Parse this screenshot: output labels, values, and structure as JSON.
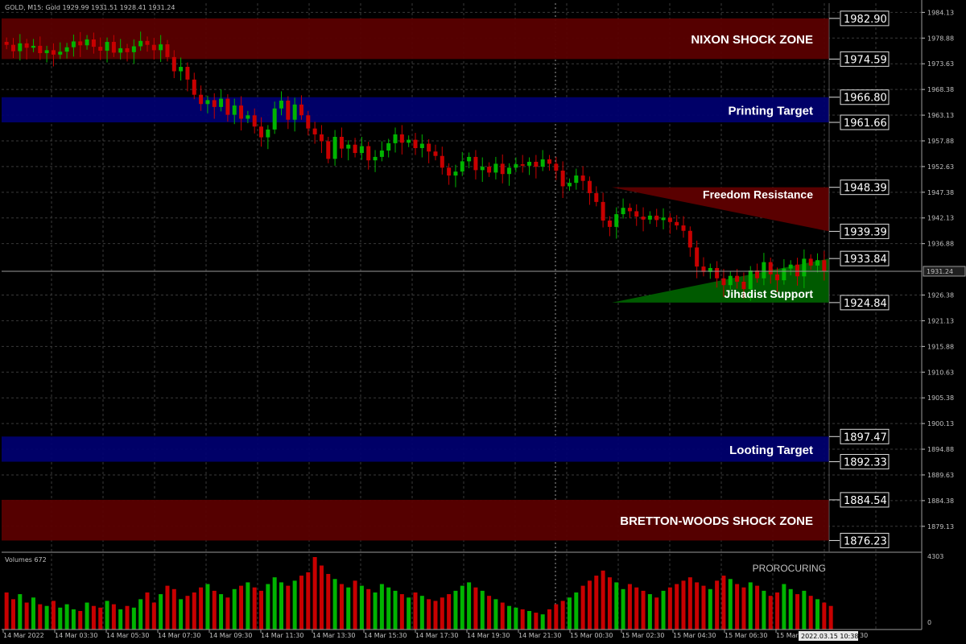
{
  "header": {
    "symbol_info": "GOLD, M15:  Gold  1929.99 1931.51 1928.41 1931.24",
    "volume_label": "Volumes 672",
    "indicator_label": "PROROCURING"
  },
  "colors": {
    "background": "#000000",
    "grid": "#3a3a3a",
    "bull": "#00b400",
    "bear": "#c80000",
    "red_zone": "#5a0000",
    "blue_zone": "#00006e",
    "green_triangle": "#005a00",
    "red_triangle": "#5a0000",
    "axis_text": "#c0c0c0"
  },
  "chart_data": {
    "type": "candlestick",
    "y_min": 1874.0,
    "y_max": 1986.0,
    "price_ticks": [
      "1984.13",
      "1978.88",
      "1973.63",
      "1968.38",
      "1963.13",
      "1957.88",
      "1952.63",
      "1947.38",
      "1942.13",
      "1936.88",
      "1926.38",
      "1921.13",
      "1915.88",
      "1910.63",
      "1905.38",
      "1900.13",
      "1894.88",
      "1889.63",
      "1884.38",
      "1879.13"
    ],
    "current_price": "1931.24",
    "zones": [
      {
        "label": "NIXON SHOCK ZONE",
        "top": "1982.90",
        "bottom": "1974.59",
        "color": "red"
      },
      {
        "label": "Printing Target",
        "top": "1966.80",
        "bottom": "1961.66",
        "color": "blue"
      },
      {
        "label": "Looting Target",
        "top": "1897.47",
        "bottom": "1892.33",
        "color": "blue"
      },
      {
        "label": "BRETTON-WOODS SHOCK ZONE",
        "top": "1884.54",
        "bottom": "1876.23",
        "color": "red"
      }
    ],
    "triangles": [
      {
        "label": "Freedom Resistance",
        "high": "1948.39",
        "low": "1939.39",
        "color": "red"
      },
      {
        "label": "Jihadist Support",
        "high": "1933.84",
        "low": "1924.84",
        "color": "green"
      }
    ],
    "time_labels": [
      "14 Mar 2022",
      "14 Mar 03:30",
      "14 Mar 05:30",
      "14 Mar 07:30",
      "14 Mar 09:30",
      "14 Mar 11:30",
      "14 Mar 13:30",
      "14 Mar 15:30",
      "14 Mar 17:30",
      "14 Mar 19:30",
      "14 Mar 21:30",
      "15 Mar 00:30",
      "15 Mar 02:30",
      "15 Mar 04:30",
      "15 Mar 06:30",
      "15 Mar"
    ],
    "cursor_time": "2022.03.15 10:38",
    "cursor_time_suffix": "30",
    "volume_max": "4303",
    "volume_min": "0",
    "closes": [
      1977.5,
      1976.2,
      1977.8,
      1976.9,
      1977.3,
      1975.8,
      1976.4,
      1975.5,
      1976.1,
      1977.0,
      1978.2,
      1977.4,
      1978.6,
      1977.1,
      1976.3,
      1978.1,
      1975.9,
      1976.8,
      1976.0,
      1977.2,
      1978.3,
      1977.5,
      1976.4,
      1977.6,
      1975.0,
      1972.1,
      1973.0,
      1970.4,
      1967.3,
      1965.4,
      1966.2,
      1964.8,
      1966.5,
      1963.2,
      1965.1,
      1962.4,
      1963.1,
      1960.8,
      1958.6,
      1960.2,
      1964.5,
      1966.1,
      1962.2,
      1965.3,
      1963.1,
      1960.4,
      1959.2,
      1957.8,
      1954.2,
      1958.7,
      1956.3,
      1957.1,
      1955.4,
      1956.8,
      1953.9,
      1954.6,
      1955.9,
      1957.4,
      1959.2,
      1957.5,
      1958.1,
      1956.4,
      1957.3,
      1955.7,
      1954.8,
      1952.4,
      1950.8,
      1951.6,
      1953.7,
      1954.6,
      1951.9,
      1952.6,
      1951.4,
      1953.2,
      1951.1,
      1952.4,
      1953.1,
      1952.8,
      1953.6,
      1952.6,
      1954.1,
      1953.2,
      1951.8,
      1948.6,
      1949.3,
      1950.8,
      1949.7,
      1947.2,
      1945.4,
      1941.6,
      1940.3,
      1942.9,
      1944.2,
      1943.5,
      1942.4,
      1941.8,
      1942.6,
      1941.7,
      1942.2,
      1941.3,
      1940.6,
      1939.5,
      1936.1,
      1932.2,
      1931.1,
      1931.9,
      1929.8,
      1928.4,
      1930.3,
      1929.1,
      1927.6,
      1931.4,
      1929.8,
      1933.1,
      1930.6,
      1929.4,
      1931.8,
      1932.6,
      1930.2,
      1933.8,
      1932.4,
      1933.5,
      1931.24
    ],
    "volumes": [
      2200,
      1800,
      2100,
      1600,
      1900,
      1500,
      1400,
      1700,
      1300,
      1500,
      1200,
      1100,
      1600,
      1400,
      1300,
      1700,
      1500,
      1200,
      1400,
      1300,
      1800,
      2200,
      1600,
      2100,
      2600,
      2400,
      1800,
      2000,
      2200,
      2500,
      2700,
      2300,
      2100,
      1900,
      2400,
      2600,
      2800,
      2500,
      2300,
      2700,
      3100,
      2800,
      2600,
      2900,
      3200,
      3400,
      4303,
      3800,
      3300,
      3000,
      2700,
      2500,
      2900,
      2600,
      2400,
      2200,
      2700,
      2500,
      2300,
      2100,
      1900,
      2200,
      2000,
      1800,
      1700,
      1900,
      2100,
      2300,
      2600,
      2800,
      2500,
      2300,
      2000,
      1800,
      1600,
      1400,
      1300,
      1200,
      1100,
      1000,
      900,
      1200,
      1500,
      1700,
      1900,
      2200,
      2600,
      2900,
      3200,
      3500,
      3100,
      2800,
      2400,
      2700,
      2500,
      2300,
      2100,
      1900,
      2300,
      2500,
      2700,
      2900,
      3100,
      2800,
      2600,
      2400,
      2900,
      3200,
      3000,
      2700,
      2500,
      2800,
      2600,
      2300,
      2000,
      2200,
      2700,
      2400,
      2100,
      2300,
      2000,
      1800,
      1600,
      1400
    ]
  }
}
